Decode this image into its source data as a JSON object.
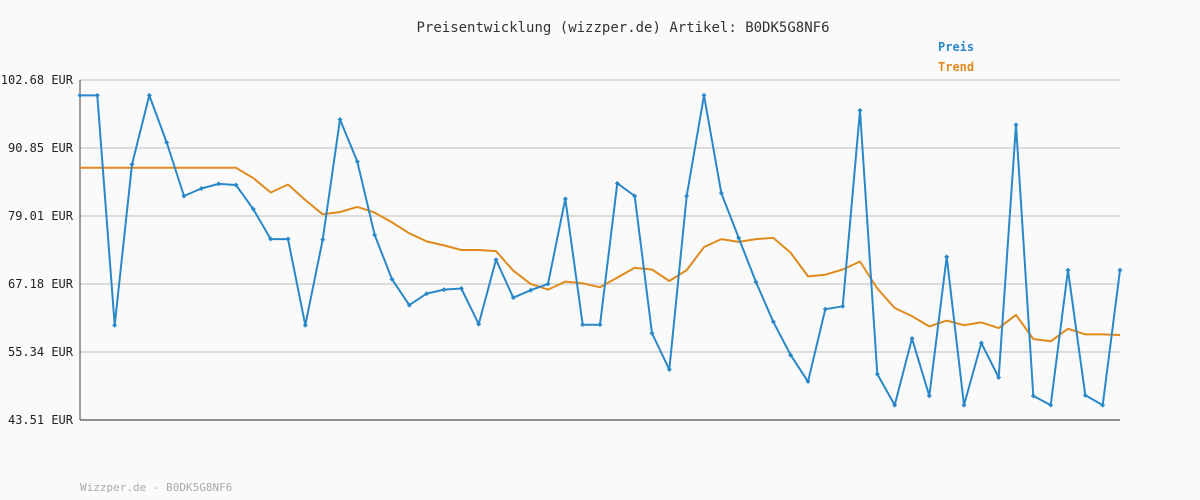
{
  "chart_data": {
    "type": "line",
    "title": "Preisentwicklung (wizzper.de) Artikel: B0DK5G8NF6",
    "footer": "Wizzper.de - B0DK5G8NF6",
    "y_ticks": [
      "102.68 EUR",
      "90.85 EUR",
      "79.01 EUR",
      "67.18 EUR",
      "55.34 EUR",
      "43.51 EUR"
    ],
    "y_tick_values": [
      102.68,
      90.85,
      79.01,
      67.18,
      55.34,
      43.51
    ],
    "ylim": [
      43.51,
      102.68
    ],
    "grid": true,
    "legend_position": "top-right",
    "series": [
      {
        "name": "Preis",
        "color": "#2a88c8",
        "values": [
          100.0,
          100.0,
          60.0,
          88.0,
          100.0,
          91.8,
          82.5,
          83.8,
          84.6,
          84.4,
          80.2,
          75.0,
          75.0,
          60.0,
          74.9,
          95.8,
          88.5,
          75.7,
          68.0,
          63.5,
          65.5,
          66.2,
          66.4,
          60.2,
          71.4,
          64.8,
          66.1,
          67.2,
          82.0,
          60.1,
          60.1,
          84.7,
          82.5,
          58.6,
          52.3,
          82.5,
          100.0,
          83.0,
          75.2,
          67.5,
          60.6,
          54.8,
          50.2,
          62.8,
          63.3,
          97.4,
          51.5,
          46.1,
          57.7,
          47.7,
          71.9,
          46.1,
          56.9,
          50.9,
          94.9,
          47.7,
          46.1,
          69.6,
          47.8,
          46.1,
          69.6
        ]
      },
      {
        "name": "Trend",
        "color": "#e08a1e",
        "values": [
          87.4,
          87.4,
          87.4,
          87.4,
          87.4,
          87.4,
          87.4,
          87.4,
          87.4,
          87.4,
          85.6,
          83.1,
          84.5,
          81.8,
          79.3,
          79.7,
          80.6,
          79.6,
          77.9,
          76.0,
          74.6,
          73.9,
          73.1,
          73.1,
          72.9,
          69.5,
          67.2,
          66.2,
          67.6,
          67.3,
          66.6,
          68.3,
          70.0,
          69.7,
          67.7,
          69.6,
          73.6,
          75.0,
          74.5,
          75.0,
          75.2,
          72.6,
          68.5,
          68.8,
          69.7,
          71.1,
          66.4,
          63.0,
          61.6,
          59.8,
          60.8,
          60.0,
          60.5,
          59.5,
          61.8,
          57.6,
          57.2,
          59.4,
          58.4,
          58.4,
          58.3
        ]
      }
    ]
  }
}
